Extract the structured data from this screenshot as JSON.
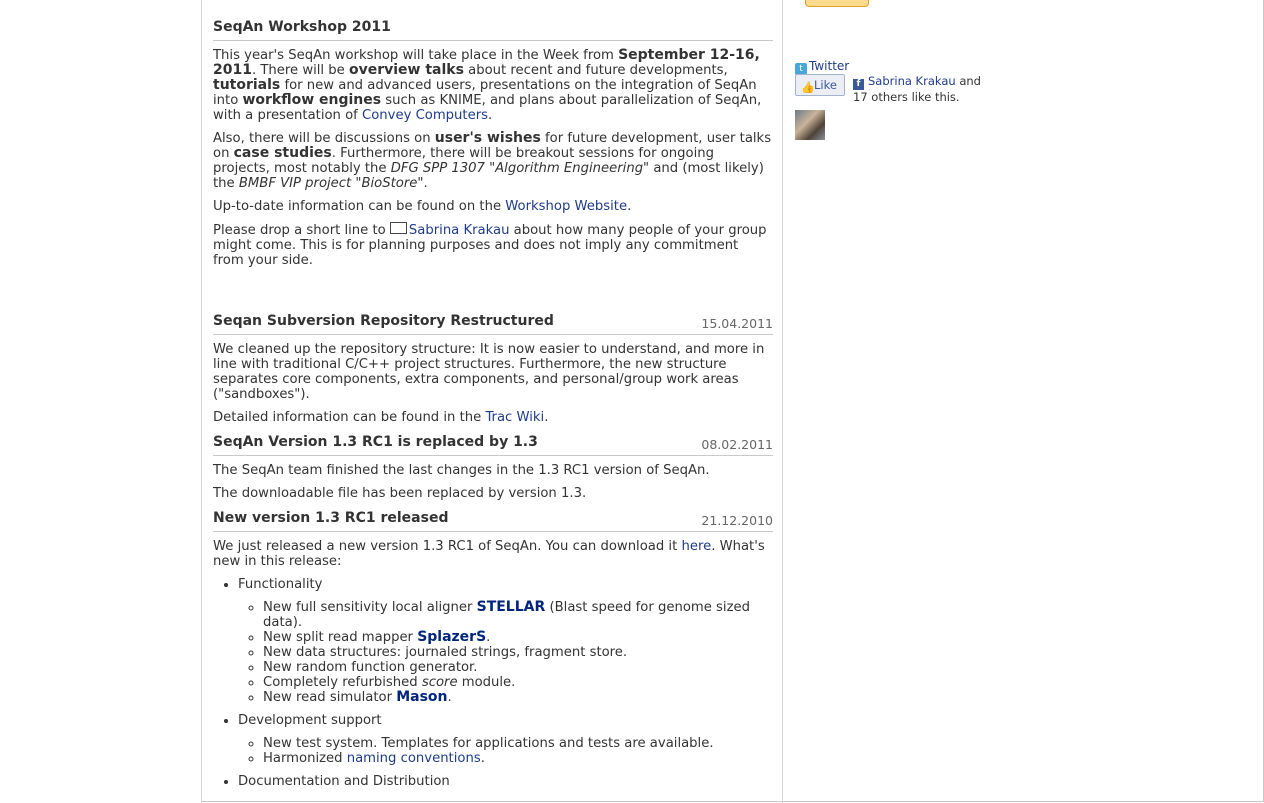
{
  "sidebar": {
    "twitter_label": "Twitter",
    "like_label": "Like",
    "like_person": "Sabrina Krakau",
    "like_and": "and",
    "like_rest": "17 others like this."
  },
  "posts": {
    "workshop": {
      "title": "SeqAn Workshop 2011",
      "p1_a": "This year's SeqAn workshop will take place in the Week from ",
      "p1_b": "September 12-16, 2011",
      "p1_c": ". There will be ",
      "p1_d": "overview talks",
      "p1_e": " about recent and future developments, ",
      "p1_f": "tutorials",
      "p1_g": " for new and advanced users, presentations on the integration of SeqAn into ",
      "p1_h": "workflow engines",
      "p1_i": " such as KNIME, and plans about parallelization of SeqAn, with a presentation of ",
      "p1_link": "Convey Computers",
      "p1_end": ".",
      "p2_a": "Also, there will be discussions on ",
      "p2_b": "user's wishes",
      "p2_c": " for future development, user talks on ",
      "p2_d": "case studies",
      "p2_e": ". Furthermore, there will be breakout sessions for ongoing projects, most notably the ",
      "p2_f": "DFG SPP 1307 \"Algorithm Engineering\"",
      "p2_g": " and (most likely) the ",
      "p2_h": "BMBF VIP project \"BioStore\"",
      "p2_end": ".",
      "p3_a": "Up-to-date information can be found on the ",
      "p3_link": "Workshop Website",
      "p3_end": ".",
      "p4_a": "Please drop a short line to ",
      "p4_link": "Sabrina Krakau",
      "p4_b": " about how many people of your group might come. This is for planning purposes and does not imply any commitment from your side."
    },
    "svn": {
      "title": "Seqan Subversion Repository Restructured",
      "date": "15.04.2011",
      "p1": "We cleaned up the repository structure: It is now easier to understand, and more in line with traditional C/C++ project structures. Furthermore, the new structure separates core components, extra components, and personal/group work areas (\"sandboxes\").",
      "p2_a": "Detailed information can be found in the ",
      "p2_link": "Trac Wiki",
      "p2_end": "."
    },
    "v13": {
      "title": "SeqAn Version 1.3 RC1 is replaced by 1.3",
      "date": "08.02.2011",
      "p1": "The SeqAn team finished the last changes in the 1.3 RC1 version of SeqAn.",
      "p2": "The downloadable file has been replaced by version 1.3."
    },
    "rc1": {
      "title": "New version 1.3 RC1 released",
      "date": "21.12.2010",
      "p1_a": "We just released a new version 1.3 RC1 of SeqAn. You can download it ",
      "p1_link": "here",
      "p1_b": ". What's new in this release:",
      "functionality": "Functionality",
      "f1_a": "New full sensitivity local aligner ",
      "f1_link": "STELLAR",
      "f1_b": " (Blast speed for genome sized data).",
      "f2_a": "New split read mapper ",
      "f2_link": "SplazerS",
      "f2_b": ".",
      "f3": "New data structures: journaled strings, fragment store.",
      "f4": "New random function generator.",
      "f5_a": "Completely refurbished ",
      "f5_em": "score",
      "f5_b": " module.",
      "f6_a": "New read simulator ",
      "f6_link": "Mason",
      "f6_b": ".",
      "devsupport": "Development support",
      "d1": "New test system. Templates for applications and tests are available.",
      "d2_a": "Harmonized ",
      "d2_link": "naming conventions",
      "d2_b": ".",
      "docs": "Documentation and Distribution"
    }
  }
}
